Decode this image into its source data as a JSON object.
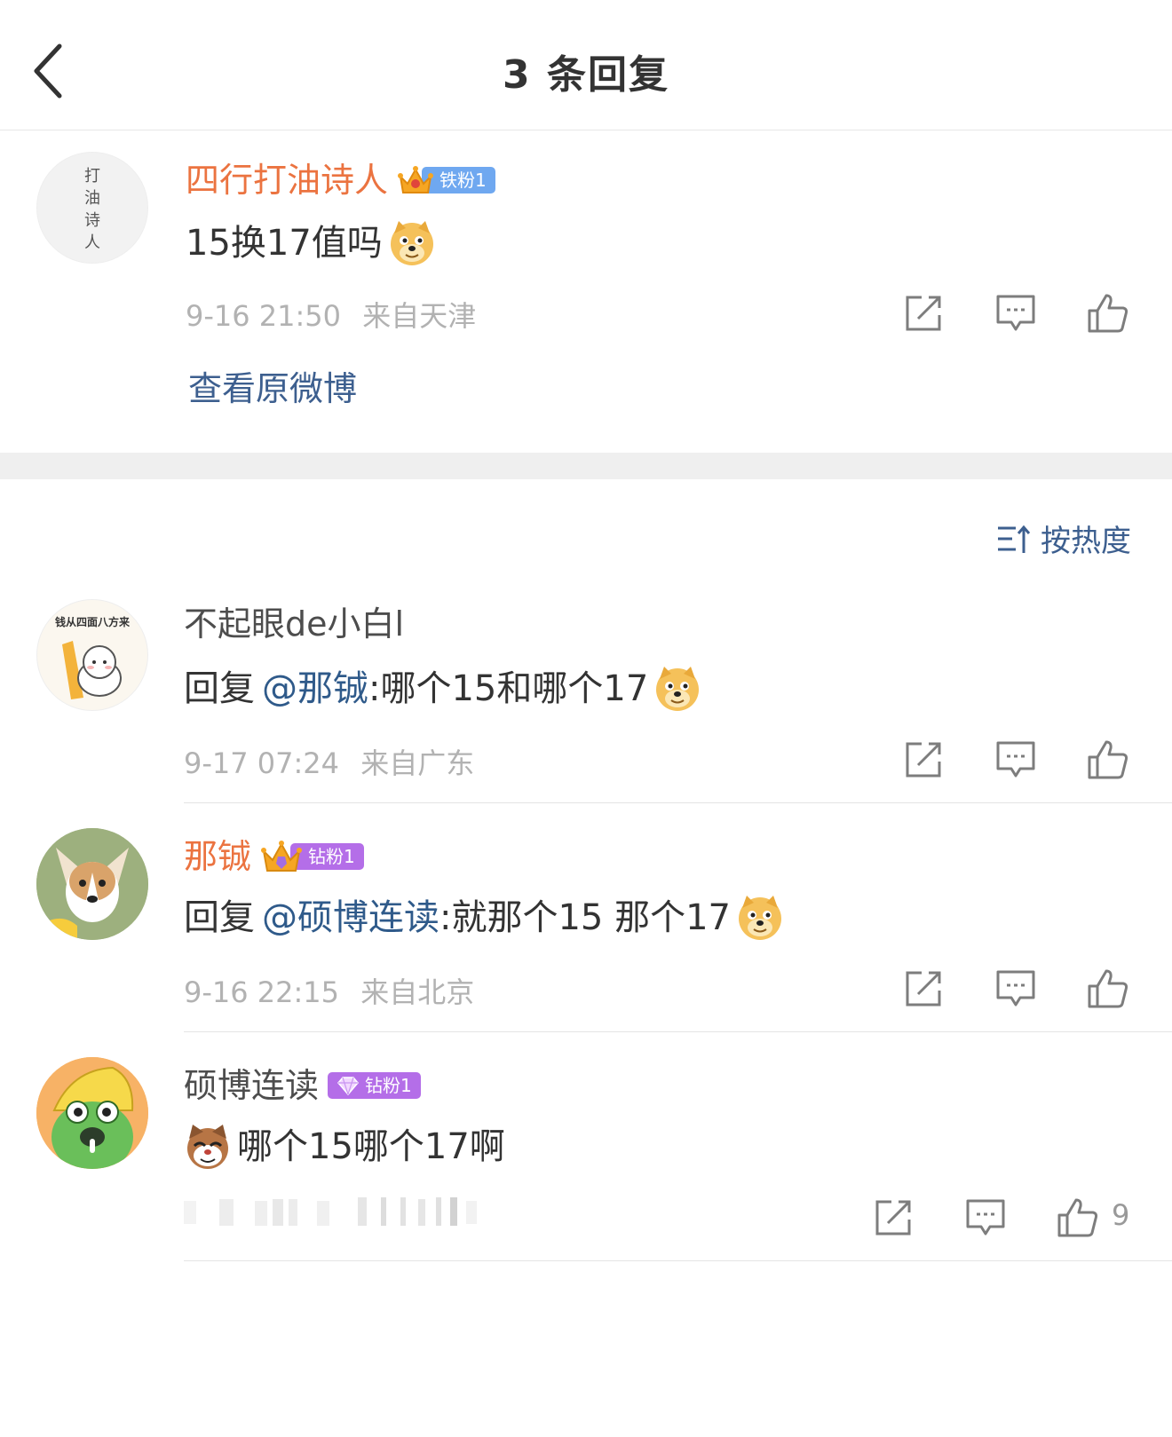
{
  "header": {
    "title": "3 条回复"
  },
  "root_comment": {
    "user": "四行打油诗人",
    "avatar_text": [
      "打",
      "油",
      "诗",
      "人"
    ],
    "badge": "铁粉1",
    "text": "15换17值吗",
    "time": "9-16 21:50",
    "location": "来自天津",
    "view_original": "查看原微博"
  },
  "sort": {
    "label": "按热度"
  },
  "replies": [
    {
      "user": "不起眼de小白l",
      "avatar_text": "钱从四面八方来",
      "reply_prefix": "回复",
      "mention": "@那铖",
      "text": ":哪个15和哪个17",
      "time": "9-17 07:24",
      "location": "来自广东"
    },
    {
      "user": "那铖",
      "badge": "钻粉1",
      "reply_prefix": "回复",
      "mention": "@硕博连读",
      "text": ":就那个15 那个17",
      "time": "9-16 22:15",
      "location": "来自北京"
    },
    {
      "user": "硕博连读",
      "badge": "钻粉1",
      "text": "哪个15哪个17啊",
      "likes": "9"
    }
  ],
  "icons": {
    "back": "chevron-left-icon",
    "share": "share-icon",
    "comment": "comment-icon",
    "like": "like-icon",
    "sort": "sort-icon",
    "doge": "doge-emoji",
    "cat": "cat-emoji"
  },
  "colors": {
    "orange_name": "#eb7340",
    "link_blue": "#3d5f8f",
    "meta_gray": "#b2b2b2",
    "iron_badge": "#6fa8f0",
    "diamond_badge": "#b46ee8"
  }
}
